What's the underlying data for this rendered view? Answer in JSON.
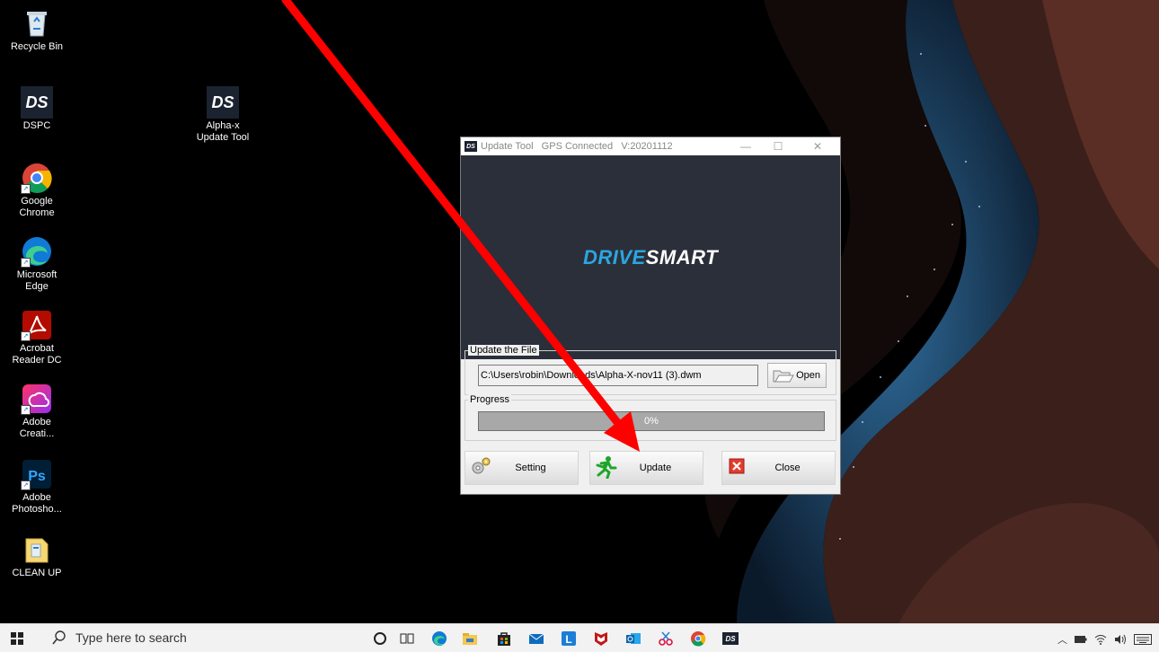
{
  "desktop": {
    "icons": [
      {
        "label": "Recycle Bin"
      },
      {
        "label": "DSPC"
      },
      {
        "label": "Alpha-x Update Tool"
      },
      {
        "label": "Google Chrome"
      },
      {
        "label": "Microsoft Edge"
      },
      {
        "label": "Acrobat Reader DC"
      },
      {
        "label": "Adobe Creati..."
      },
      {
        "label": "Adobe Photosho..."
      },
      {
        "label": "CLEAN UP"
      }
    ]
  },
  "dialog": {
    "title": "Update Tool   GPS Connected   V:20201112",
    "logo_part1": "DRIVE",
    "logo_part2": "SMART",
    "update_group_label": "Update the File",
    "file_path": "C:\\Users\\robin\\Downloads\\Alpha-X-nov11 (3).dwm",
    "open_label": "Open",
    "progress_group_label": "Progress",
    "progress_value": 0,
    "progress_text": "0%",
    "setting_label": "Setting",
    "update_label": "Update",
    "close_label": "Close"
  },
  "taskbar": {
    "search_placeholder": "Type here to search"
  },
  "colors": {
    "accent_arrow": "#ff0000",
    "logo_blue": "#2aa7e0",
    "banner_bg": "#2b2f3a"
  }
}
